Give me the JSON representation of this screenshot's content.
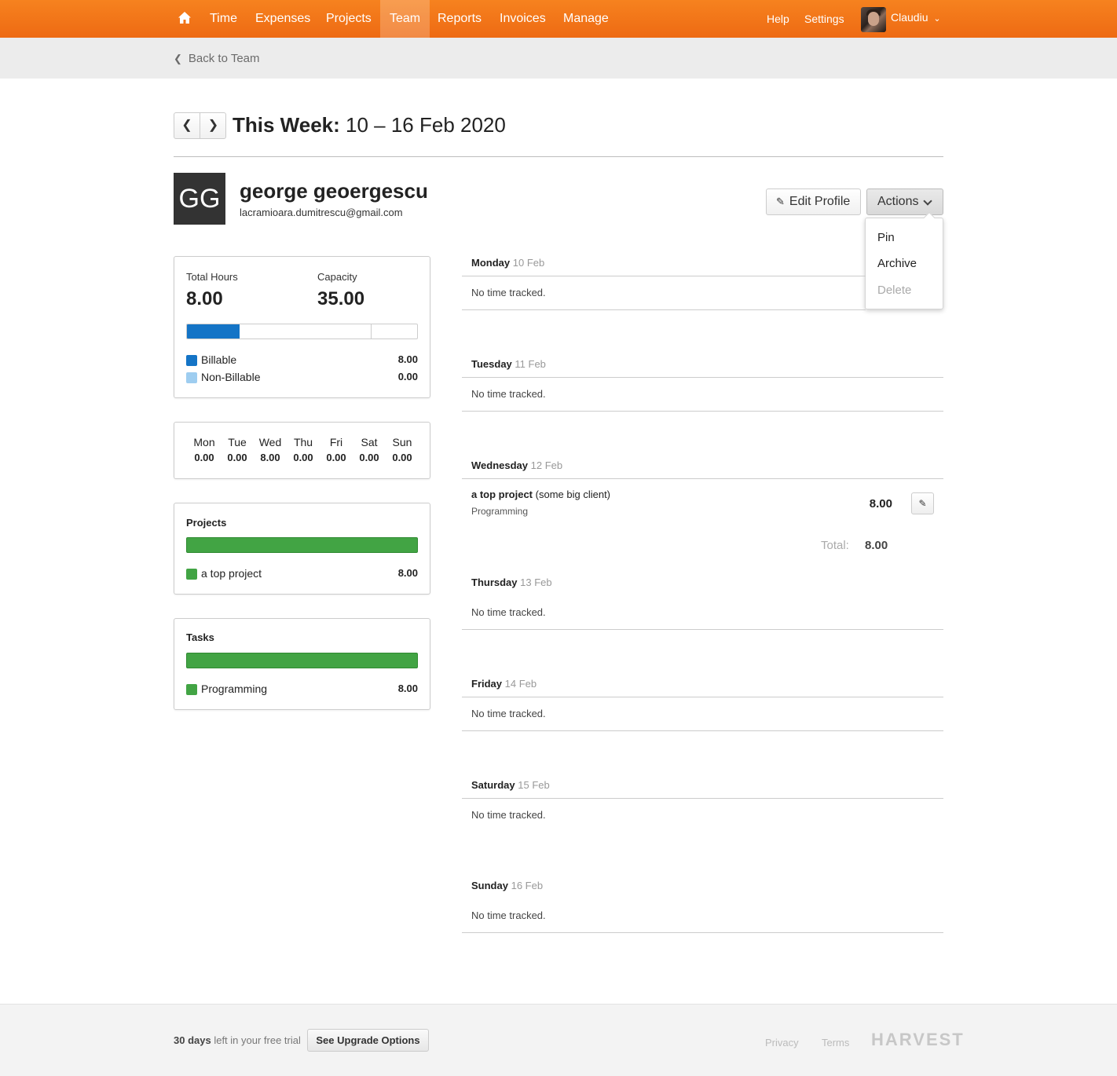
{
  "nav": {
    "items": [
      "Time",
      "Expenses",
      "Projects",
      "Team",
      "Reports",
      "Invoices",
      "Manage"
    ],
    "active": "Team",
    "help": "Help",
    "settings": "Settings",
    "user": "Claudiu"
  },
  "subbar": {
    "back_label": "Back to Team"
  },
  "week": {
    "prefix": "This Week:",
    "range": "10 – 16 Feb 2020"
  },
  "person": {
    "initials": "GG",
    "name": "george geoergescu",
    "email": "lacramioara.dumitrescu@gmail.com",
    "edit_label": "Edit Profile",
    "actions_label": "Actions",
    "actions_menu": [
      {
        "label": "Pin",
        "disabled": false
      },
      {
        "label": "Archive",
        "disabled": false
      },
      {
        "label": "Delete",
        "disabled": true
      }
    ]
  },
  "summary": {
    "total_label": "Total Hours",
    "total_value": "8.00",
    "capacity_label": "Capacity",
    "capacity_value": "35.00",
    "billable_label": "Billable",
    "billable_value": "8.00",
    "nonbillable_label": "Non-Billable",
    "nonbillable_value": "0.00",
    "billable_fraction": 0.2286,
    "colors": {
      "billable": "#1474c6",
      "nonbillable": "#9ecdf0",
      "project": "#42a444"
    }
  },
  "days": [
    {
      "short": "Mon",
      "hours": "0.00"
    },
    {
      "short": "Tue",
      "hours": "0.00"
    },
    {
      "short": "Wed",
      "hours": "8.00"
    },
    {
      "short": "Thu",
      "hours": "0.00"
    },
    {
      "short": "Fri",
      "hours": "0.00"
    },
    {
      "short": "Sat",
      "hours": "0.00"
    },
    {
      "short": "Sun",
      "hours": "0.00"
    }
  ],
  "projects": {
    "title": "Projects",
    "items": [
      {
        "name": "a top project",
        "hours": "8.00"
      }
    ]
  },
  "tasks": {
    "title": "Tasks",
    "items": [
      {
        "name": "Programming",
        "hours": "8.00"
      }
    ]
  },
  "timesheet": {
    "no_time": "No time tracked.",
    "total_label": "Total:",
    "days": [
      {
        "name": "Monday",
        "date": "10 Feb"
      },
      {
        "name": "Tuesday",
        "date": "11 Feb"
      },
      {
        "name": "Wednesday",
        "date": "12 Feb",
        "entry": {
          "project": "a top project",
          "client": "(some big client)",
          "task": "Programming",
          "hours": "8.00"
        },
        "total": "8.00"
      },
      {
        "name": "Thursday",
        "date": "13 Feb"
      },
      {
        "name": "Friday",
        "date": "14 Feb"
      },
      {
        "name": "Saturday",
        "date": "15 Feb"
      },
      {
        "name": "Sunday",
        "date": "16 Feb"
      }
    ]
  },
  "footer": {
    "trial_days": "30 days",
    "trial_rest": "left in your free trial",
    "upgrade_label": "See Upgrade Options",
    "privacy": "Privacy",
    "terms": "Terms",
    "brand": "HARVEST"
  }
}
